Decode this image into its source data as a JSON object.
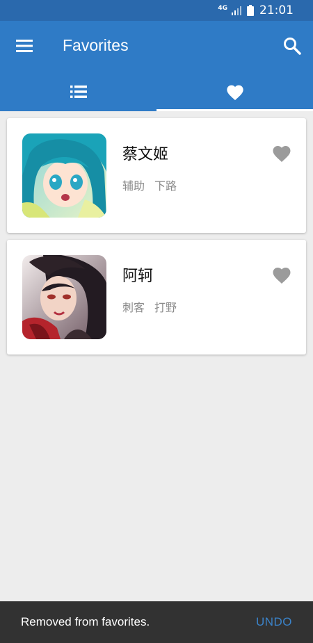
{
  "status_bar": {
    "network": "4G",
    "time": "21:01"
  },
  "app_bar": {
    "title": "Favorites",
    "menu_icon": "hamburger-menu-icon",
    "search_icon": "search-icon"
  },
  "tabs": [
    {
      "icon": "list-icon",
      "active": false
    },
    {
      "icon": "heart-icon",
      "active": true
    }
  ],
  "favorites": [
    {
      "name": "蔡文姬",
      "tags": [
        "辅助",
        "下路"
      ],
      "favorited": true
    },
    {
      "name": "阿轲",
      "tags": [
        "刺客",
        "打野"
      ],
      "favorited": true
    }
  ],
  "snackbar": {
    "message": "Removed from favorites.",
    "action": "UNDO"
  },
  "colors": {
    "primary": "#2f7bc6",
    "status_bar": "#2a69ad",
    "background": "#ededed",
    "heart_inactive": "#9b9b9b",
    "snackbar": "#323232",
    "snackbar_action": "#3b83c9"
  }
}
